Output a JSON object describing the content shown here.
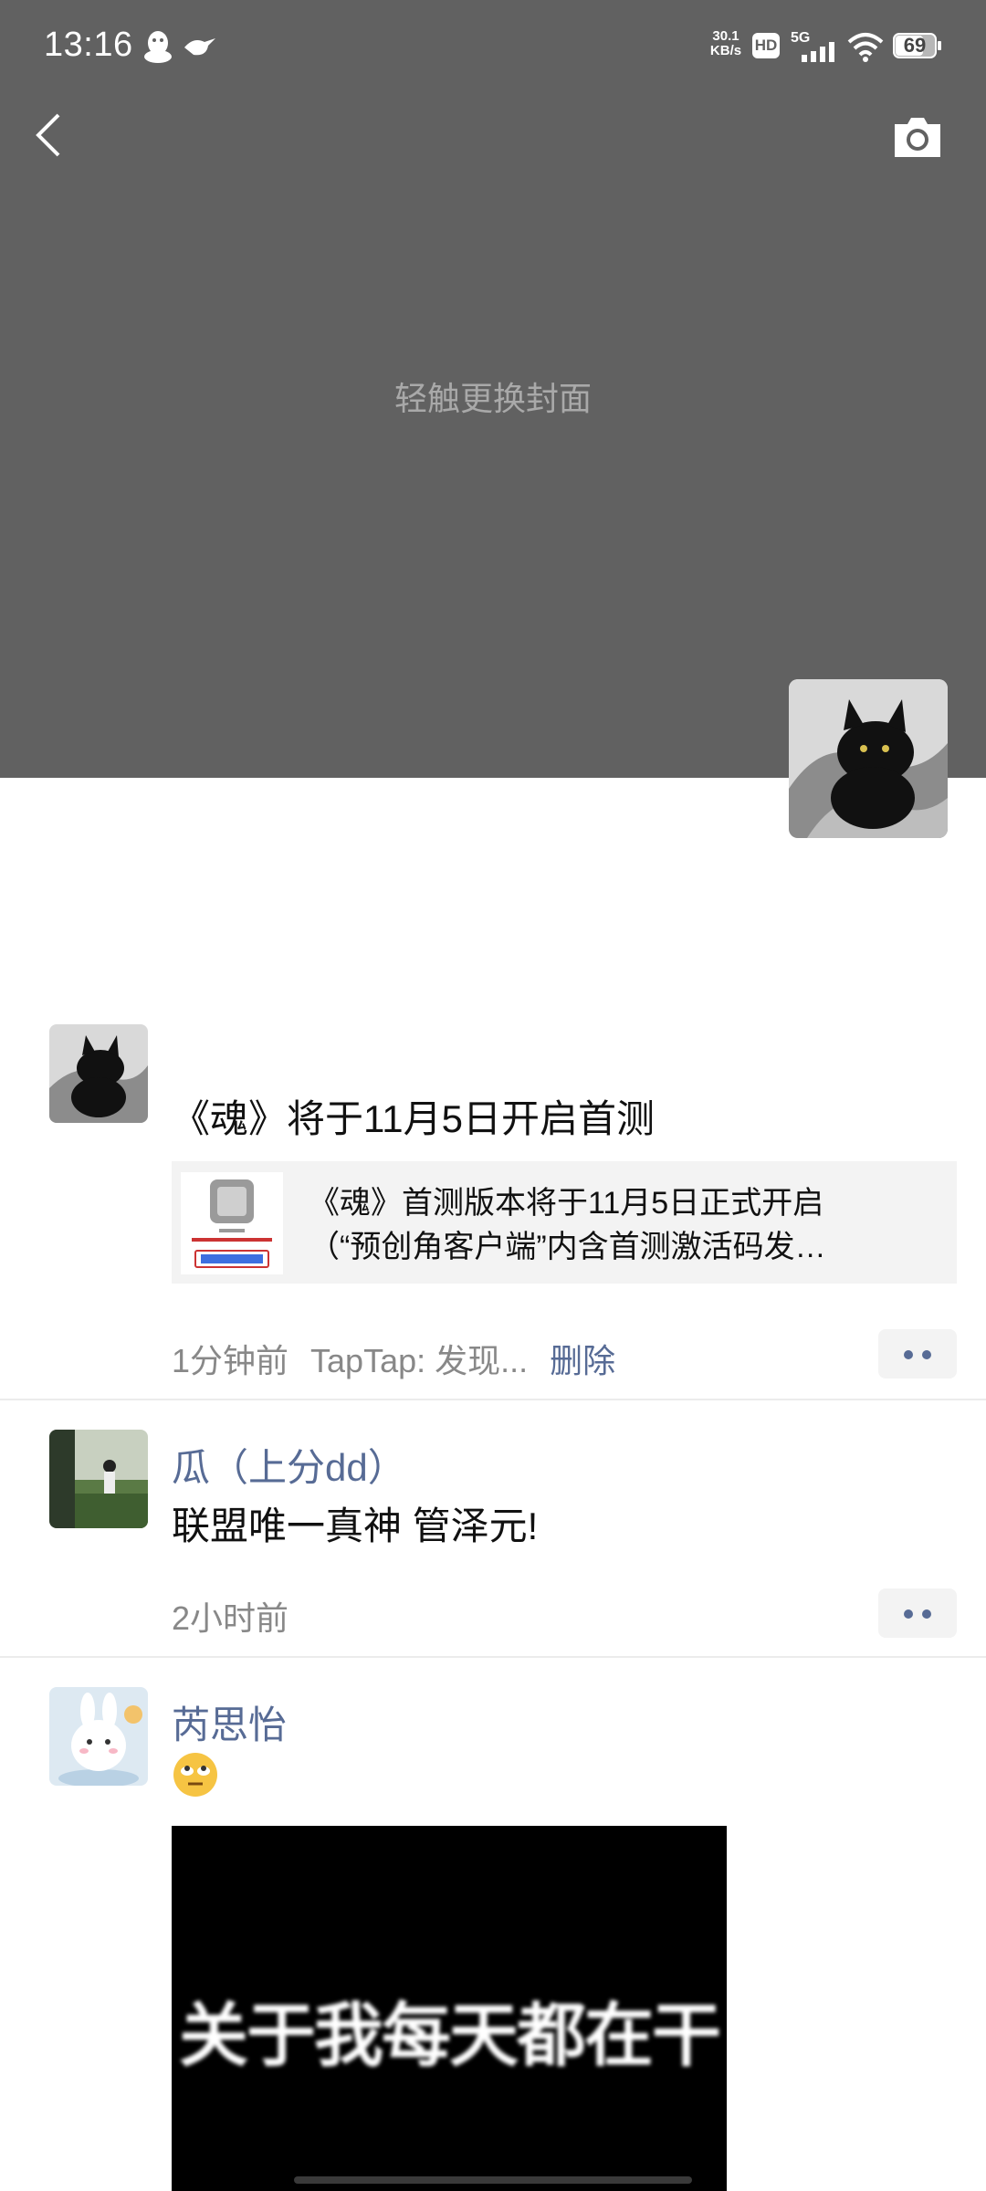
{
  "status_bar": {
    "time": "13:16",
    "net_speed": "30.1",
    "net_unit": "KB/s",
    "hd_label": "HD",
    "network_type": "5G",
    "battery": "69"
  },
  "cover": {
    "hint": "轻触更换封面",
    "back_icon": "chevron-left-icon",
    "camera_icon": "camera-icon"
  },
  "posts": [
    {
      "text": "《魂》将于11月5日开启首测",
      "link_card": {
        "line1": "《魂》首测版本将于11月5日正式开启",
        "line2": "（“预创角客户端”内含首测激活码发…"
      },
      "time": "1分钟前",
      "source": "TapTap: 发现...",
      "delete_label": "删除"
    },
    {
      "name": "瓜（上分dd）",
      "text": "联盟唯一真神 管泽元!",
      "time": "2小时前"
    },
    {
      "name": "芮思怡",
      "emoji": "eye-roll-emoji",
      "video_caption": "关于我每天都在干"
    }
  ]
}
